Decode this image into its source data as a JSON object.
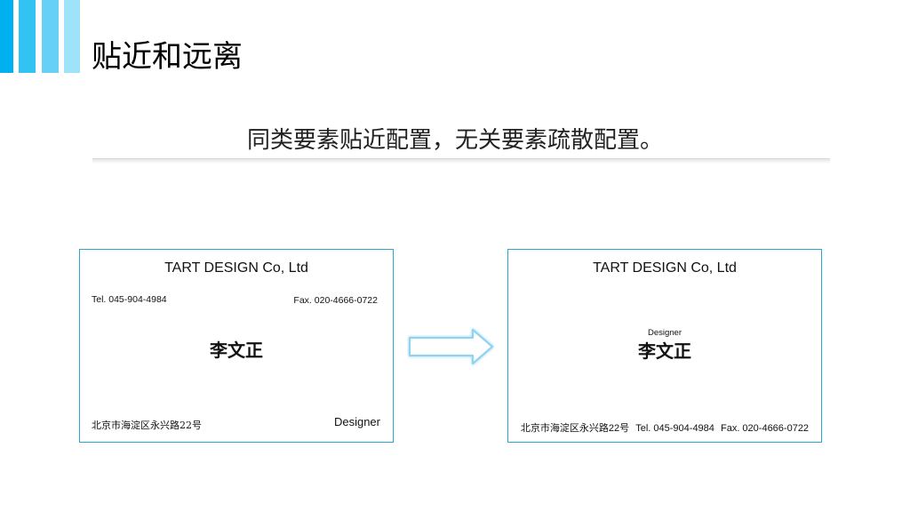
{
  "slide": {
    "title": "贴近和远离",
    "subtitle": "同类要素贴近配置，无关要素疏散配置。"
  },
  "colors": {
    "accent_1": "#00b0f0",
    "accent_2": "#33c3f3",
    "accent_3": "#66d0f6",
    "accent_4": "#9fe3fa",
    "card_border": "#29a7cf",
    "arrow_outline": "#8fd3ee"
  },
  "icons": {
    "arrow": "right-arrow-icon"
  },
  "card_before": {
    "company": "TART DESIGN Co, Ltd",
    "tel": "Tel. 045-904-4984",
    "fax": "Fax. 020-4666-0722",
    "name": "李文正",
    "address": "北京市海淀区永兴路22号",
    "role": "Designer"
  },
  "card_after": {
    "company": "TART DESIGN Co, Ltd",
    "role": "Designer",
    "name": "李文正",
    "address": "北京市海淀区永兴路22号",
    "tel": "Tel. 045-904-4984",
    "fax": "Fax. 020-4666-0722"
  }
}
